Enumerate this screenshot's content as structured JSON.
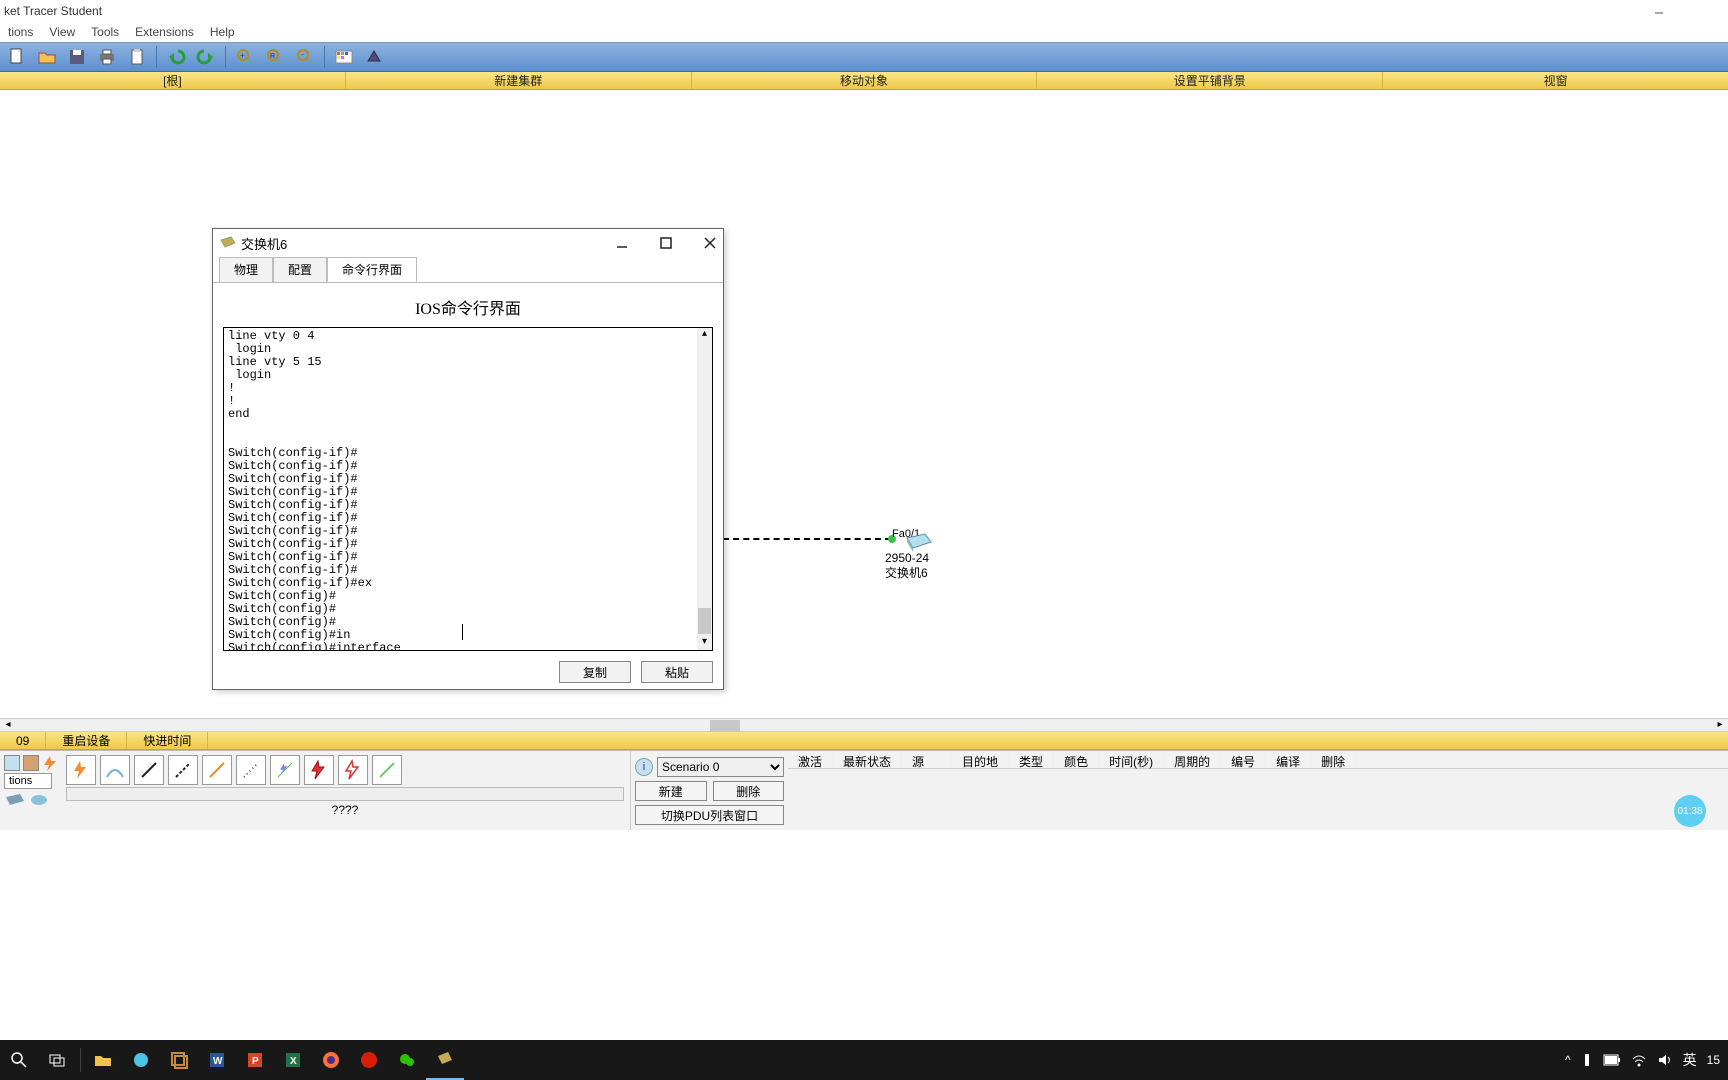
{
  "titlebar": {
    "title": "ket Tracer Student"
  },
  "menubar": {
    "items": [
      "tions",
      "View",
      "Tools",
      "Extensions",
      "Help"
    ]
  },
  "logical_bar": {
    "items": [
      "[根]",
      "新建集群",
      "移动对象",
      "设置平铺背景",
      "视窗"
    ]
  },
  "canvas": {
    "device": {
      "port": "Fa0/1",
      "model": "2950-24",
      "name": "交换机6"
    }
  },
  "dialog": {
    "title": "交换机6",
    "tabs": {
      "t0": "物理",
      "t1": "配置",
      "t2": "命令行界面"
    },
    "header": "IOS命令行界面",
    "cli": "line vty 0 4\n login\nline vty 5 15\n login\n!\n!\nend\n\n\nSwitch(config-if)#\nSwitch(config-if)#\nSwitch(config-if)#\nSwitch(config-if)#\nSwitch(config-if)#\nSwitch(config-if)#\nSwitch(config-if)#\nSwitch(config-if)#\nSwitch(config-if)#\nSwitch(config-if)#\nSwitch(config-if)#ex\nSwitch(config)#\nSwitch(config)#\nSwitch(config)#\nSwitch(config)#in\nSwitch(config)#interface ",
    "btn_copy": "复制",
    "btn_paste": "粘贴"
  },
  "bottom_yellow": {
    "b0": "09",
    "b1": "重启设备",
    "b2": "快进时间"
  },
  "pdu": {
    "scenario": "Scenario 0",
    "btn_new": "新建",
    "btn_del": "删除",
    "btn_toggle": "切换PDU列表窗口"
  },
  "pdu_table": {
    "headers": [
      "激活",
      "最新状态",
      "源",
      "目的地",
      "类型",
      "颜色",
      "时间(秒)",
      "周期的",
      "编号",
      "编译",
      "删除"
    ]
  },
  "conn_label": "tions",
  "conn_qmark": "????",
  "bili": "01:38",
  "taskbar": {
    "ime": "英",
    "time": "15"
  }
}
